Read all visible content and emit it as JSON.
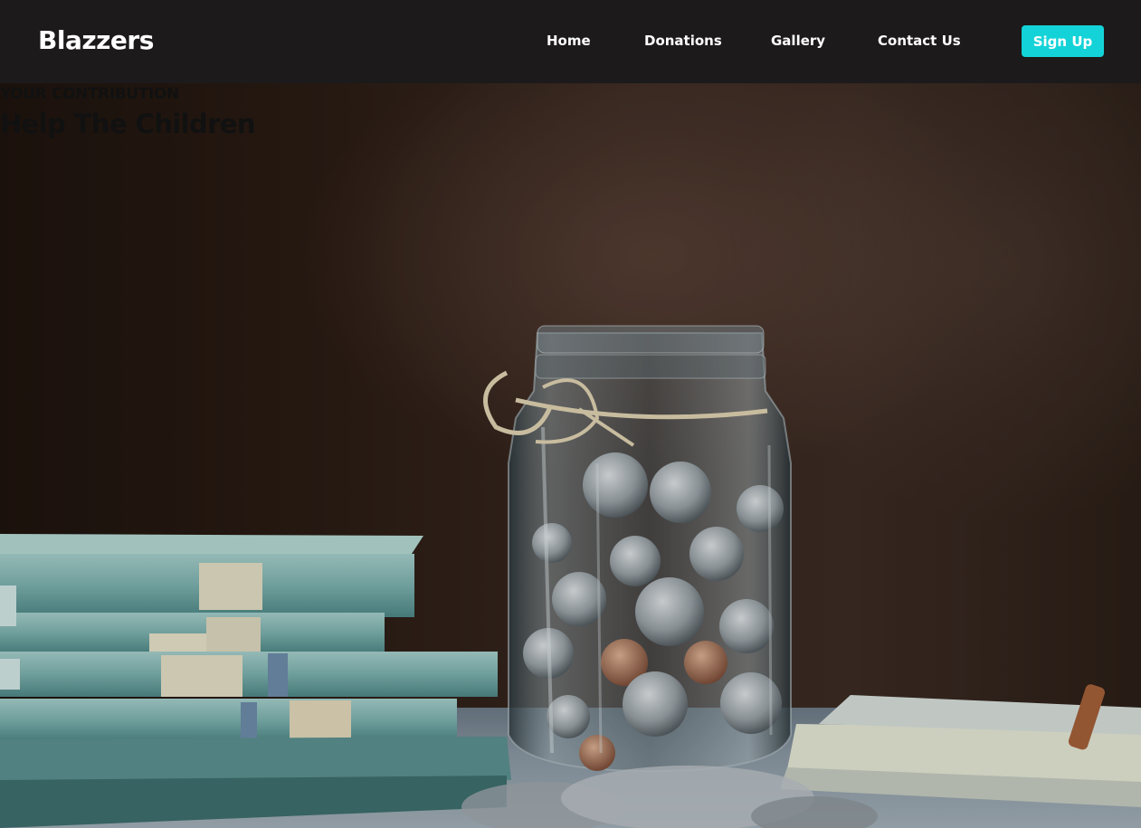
{
  "navbar": {
    "brand": "Blazzers",
    "links": [
      {
        "label": "Home"
      },
      {
        "label": "Donations"
      },
      {
        "label": "Gallery"
      },
      {
        "label": "Contact Us"
      }
    ],
    "signup_label": "Sign Up"
  },
  "hero": {
    "eyebrow": "YOUR CONTRIBUTION",
    "title": "Help The Children",
    "image_description_icon": "coin-jar-photo"
  },
  "colors": {
    "navbar_bg": "#1c1a1b",
    "accent": "#14d3d8",
    "text_light": "#ffffff",
    "hero_text": "#111111"
  }
}
